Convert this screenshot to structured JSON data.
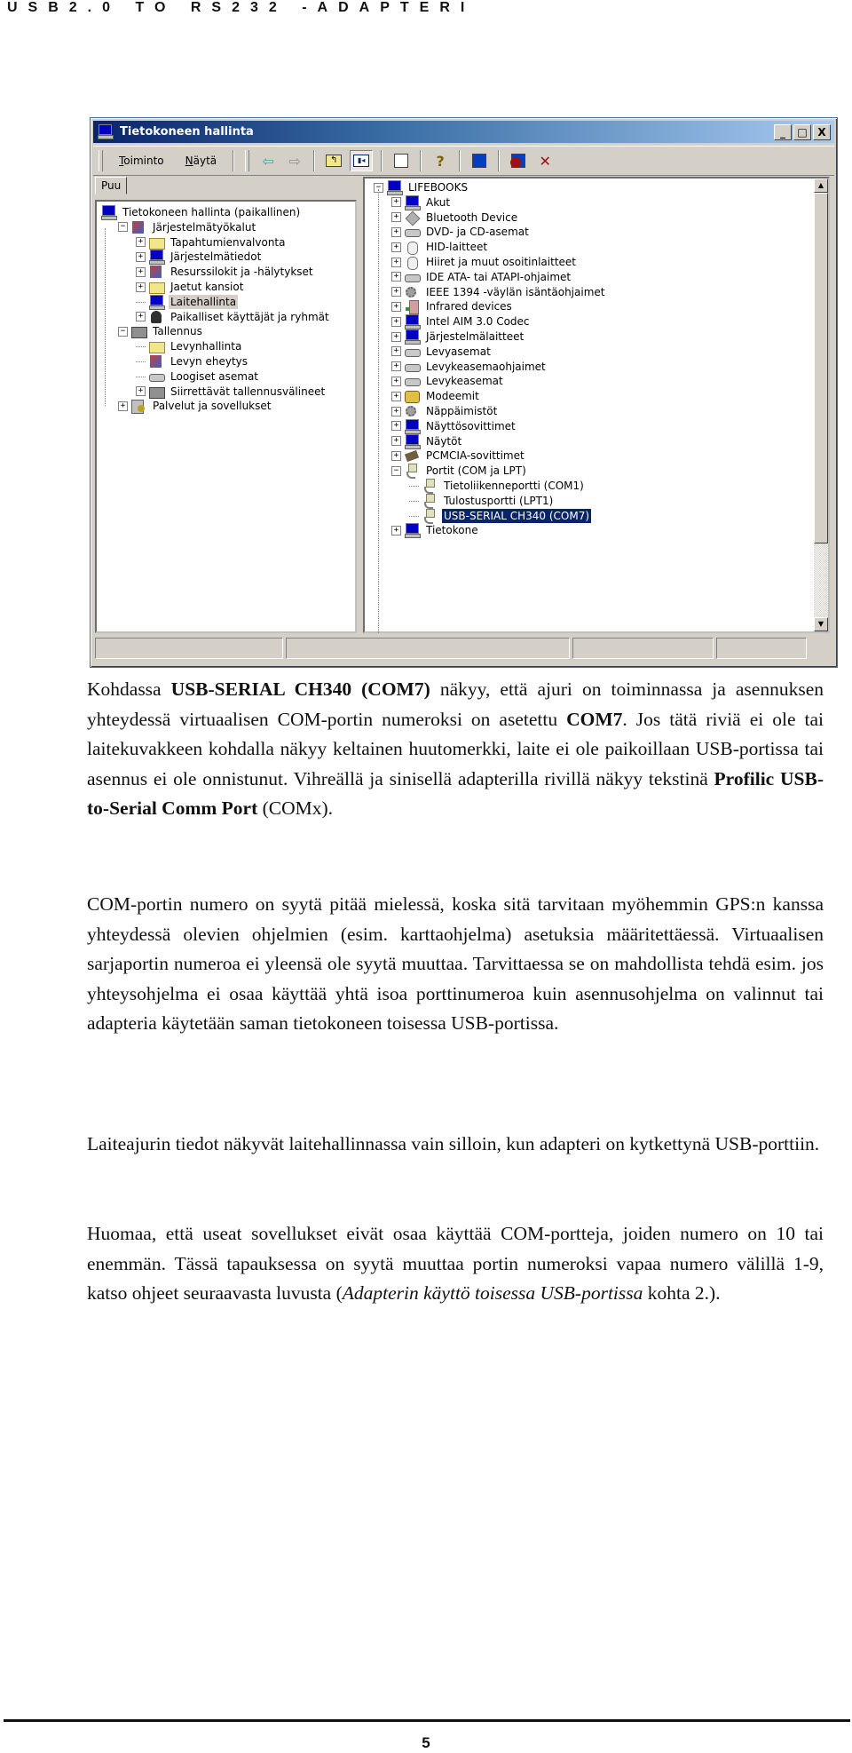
{
  "page_header": "USB2.0 TO RS232 -ADAPTERI",
  "window": {
    "title": "Tietokoneen hallinta",
    "title_buttons": [
      "_",
      "□",
      "X"
    ],
    "menu": [
      {
        "label": "Toiminto",
        "accel": "T",
        "rest": "oiminto"
      },
      {
        "label": "Näytä",
        "accel": "N",
        "rest": "äytä"
      }
    ],
    "toolbar_icons": [
      "back-arrow-icon",
      "forward-arrow-icon",
      "up-folder-icon",
      "show-hide-tree-icon",
      "properties-icon",
      "help-icon",
      "scan-hardware-icon",
      "disable-device-icon",
      "uninstall-device-icon"
    ],
    "left_tab": "Puu",
    "left_tree": [
      {
        "label": "Tietokoneen hallinta (paikallinen)",
        "level": 0,
        "expander": "none",
        "icon": "computer-icon"
      },
      {
        "label": "Järjestelmätyökalut",
        "level": 1,
        "expander": "minus",
        "icon": "system-tools-icon"
      },
      {
        "label": "Tapahtumienvalvonta",
        "level": 2,
        "expander": "plus",
        "icon": "event-viewer-icon"
      },
      {
        "label": "Järjestelmätiedot",
        "level": 2,
        "expander": "plus",
        "icon": "system-info-icon"
      },
      {
        "label": "Resurssilokit ja -hälytykset",
        "level": 2,
        "expander": "plus",
        "icon": "performance-logs-icon"
      },
      {
        "label": "Jaetut kansiot",
        "level": 2,
        "expander": "plus",
        "icon": "shared-folders-icon"
      },
      {
        "label": "Laitehallinta",
        "level": 2,
        "expander": "none",
        "icon": "device-manager-icon",
        "highlighted": true
      },
      {
        "label": "Paikalliset käyttäjät ja ryhmät",
        "level": 2,
        "expander": "plus",
        "icon": "local-users-icon"
      },
      {
        "label": "Tallennus",
        "level": 1,
        "expander": "minus",
        "icon": "storage-icon"
      },
      {
        "label": "Levynhallinta",
        "level": 2,
        "expander": "none",
        "icon": "disk-management-icon"
      },
      {
        "label": "Levyn eheytys",
        "level": 2,
        "expander": "none",
        "icon": "defragmenter-icon"
      },
      {
        "label": "Loogiset asemat",
        "level": 2,
        "expander": "none",
        "icon": "logical-drives-icon"
      },
      {
        "label": "Siirrettävät tallennusvälineet",
        "level": 2,
        "expander": "plus",
        "icon": "removable-storage-icon"
      },
      {
        "label": "Palvelut ja sovellukset",
        "level": 1,
        "expander": "plus",
        "icon": "services-icon"
      }
    ],
    "right_tree": [
      {
        "label": "LIFEBOOKS",
        "level": 0,
        "expander": "minus",
        "icon": "computer-icon"
      },
      {
        "label": "Akut",
        "level": 1,
        "expander": "plus",
        "icon": "battery-icon"
      },
      {
        "label": "Bluetooth Device",
        "level": 1,
        "expander": "plus",
        "icon": "bluetooth-icon"
      },
      {
        "label": "DVD- ja CD-asemat",
        "level": 1,
        "expander": "plus",
        "icon": "cd-drive-icon"
      },
      {
        "label": "HID-laitteet",
        "level": 1,
        "expander": "plus",
        "icon": "hid-icon"
      },
      {
        "label": "Hiiret ja muut osoitinlaitteet",
        "level": 1,
        "expander": "plus",
        "icon": "mouse-icon"
      },
      {
        "label": "IDE ATA- tai ATAPI-ohjaimet",
        "level": 1,
        "expander": "plus",
        "icon": "ide-controller-icon"
      },
      {
        "label": "IEEE 1394 -väylän isäntäohjaimet",
        "level": 1,
        "expander": "plus",
        "icon": "ieee1394-icon"
      },
      {
        "label": "Infrared devices",
        "level": 1,
        "expander": "plus",
        "icon": "infrared-icon"
      },
      {
        "label": "Intel AIM 3.0 Codec",
        "level": 1,
        "expander": "plus",
        "icon": "monitor-icon"
      },
      {
        "label": "Järjestelmälaitteet",
        "level": 1,
        "expander": "plus",
        "icon": "system-devices-icon"
      },
      {
        "label": "Levyasemat",
        "level": 1,
        "expander": "plus",
        "icon": "disk-drive-icon"
      },
      {
        "label": "Levykeasemaohjaimet",
        "level": 1,
        "expander": "plus",
        "icon": "floppy-controller-icon"
      },
      {
        "label": "Levykeasemat",
        "level": 1,
        "expander": "plus",
        "icon": "floppy-drive-icon"
      },
      {
        "label": "Modeemit",
        "level": 1,
        "expander": "plus",
        "icon": "modem-icon"
      },
      {
        "label": "Näppäimistöt",
        "level": 1,
        "expander": "plus",
        "icon": "keyboard-icon"
      },
      {
        "label": "Näyttösovittimet",
        "level": 1,
        "expander": "plus",
        "icon": "display-adapter-icon"
      },
      {
        "label": "Näytöt",
        "level": 1,
        "expander": "plus",
        "icon": "monitor-icon"
      },
      {
        "label": "PCMCIA-sovittimet",
        "level": 1,
        "expander": "plus",
        "icon": "pcmcia-icon"
      },
      {
        "label": "Portit (COM ja LPT)",
        "level": 1,
        "expander": "minus",
        "icon": "port-icon"
      },
      {
        "label": "Tietoliikenneportti (COM1)",
        "level": 2,
        "expander": "none",
        "icon": "port-icon"
      },
      {
        "label": "Tulostusportti (LPT1)",
        "level": 2,
        "expander": "none",
        "icon": "port-icon"
      },
      {
        "label": "USB-SERIAL CH340 (COM7)",
        "level": 2,
        "expander": "none",
        "icon": "port-icon",
        "selected": true
      },
      {
        "label": "Tietokone",
        "level": 1,
        "expander": "plus",
        "icon": "computer-icon"
      }
    ]
  },
  "paragraphs": [
    {
      "lead": "Kohdassa ",
      "bold1": "USB-SERIAL CH340 (COM7)",
      "mid1": " näkyy, että ajuri on toiminnassa ja asennuksen yhteydessä virtuaalisen COM-portin numeroksi on asetettu ",
      "bold2": "COM7",
      "mid2": ". Jos tätä riviä ei ole tai laitekuvakkeen kohdalla näkyy keltainen huutomerkki, laite ei ole paikoillaan USB-portissa tai asennus ei ole onnistunut. Vihreällä ja sinisellä adapterilla rivillä näkyy tekstinä ",
      "bold3": "Profilic USB-to-Serial Comm Port",
      "tail": " (COMx)."
    },
    {
      "text": "COM-portin numero on syytä pitää mielessä, koska sitä tarvitaan myöhemmin GPS:n kanssa yhteydessä olevien ohjelmien (esim. karttaohjelma) asetuksia määritettäessä. Virtuaalisen sarjaportin numeroa ei yleensä ole syytä muuttaa. Tarvittaessa se on mahdollista tehdä esim. jos yhteysohjelma ei osaa käyttää yhtä isoa porttinumeroa kuin asennusohjelma on valinnut tai adapteria käytetään saman tietokoneen toisessa USB-portissa."
    },
    {
      "text": "Laiteajurin tiedot näkyvät laitehallinnassa vain silloin, kun adapteri on kytkettynä USB-porttiin."
    },
    {
      "lead": "Huomaa, että useat sovellukset eivät osaa käyttää COM-portteja, joiden numero on 10 tai enemmän. Tässä tapauksessa on syytä muuttaa portin numeroksi vapaa numero välillä 1-9, katso ohjeet seuraavasta luvusta (",
      "italic": "Adapterin käyttö toisessa USB-portissa",
      "tail": " kohta 2.)."
    }
  ],
  "page_number": "5"
}
